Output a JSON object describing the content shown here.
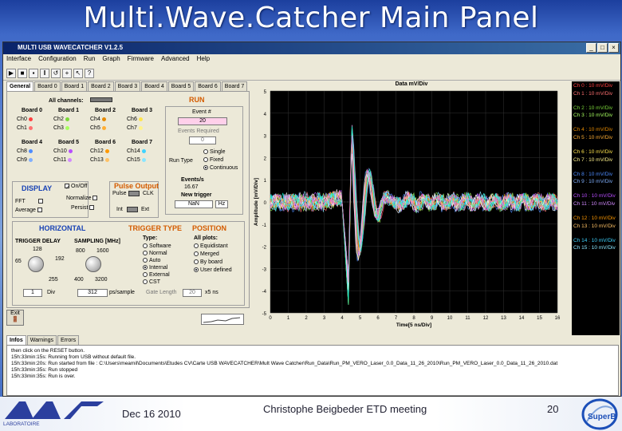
{
  "slide": {
    "title": "Multi.Wave.Catcher  Main Panel",
    "date": "Dec 16 2010",
    "meeting": "Christophe Beigbeder ETD meeting",
    "page": "20",
    "logo_left": "LABORATOIRE DE L'ACCÉLÉRATEUR LINÉAIRE",
    "logo_right": "SuperB"
  },
  "window": {
    "title": "MULTI USB WAVECATCHER V1.2.5",
    "menu": [
      "Interface",
      "Configuration",
      "Run",
      "Graph",
      "Firmware",
      "Advanced",
      "Help"
    ]
  },
  "tabs": [
    "General",
    "Board 0",
    "Board 1",
    "Board 2",
    "Board 3",
    "Board 4",
    "Board 5",
    "Board 6",
    "Board 7"
  ],
  "panel": {
    "all_channels": "All channels:",
    "boards": [
      {
        "name": "Board 0",
        "ch": [
          "Ch0",
          "Ch1"
        ]
      },
      {
        "name": "Board 1",
        "ch": [
          "Ch2",
          "Ch3"
        ]
      },
      {
        "name": "Board 2",
        "ch": [
          "Ch4",
          "Ch5"
        ]
      },
      {
        "name": "Board 3",
        "ch": [
          "Ch6",
          "Ch7"
        ]
      },
      {
        "name": "Board 4",
        "ch": [
          "Ch8",
          "Ch9"
        ]
      },
      {
        "name": "Board 5",
        "ch": [
          "Ch10",
          "Ch11"
        ]
      },
      {
        "name": "Board 6",
        "ch": [
          "Ch12",
          "Ch13"
        ]
      },
      {
        "name": "Board 7",
        "ch": [
          "Ch14",
          "Ch15"
        ]
      }
    ],
    "run": {
      "label": "RUN",
      "event_label": "Event #",
      "event_value": "20",
      "events_required_label": "Events Required",
      "events_required_value": "0",
      "run_type_label": "Run Type",
      "run_types": [
        "Single",
        "Fixed",
        "Continuous"
      ],
      "events_per_s_label": "Events/s",
      "events_per_s_value": "16.67",
      "new_trigger_label": "New trigger",
      "new_trigger_value": "NaN",
      "hz": "Hz"
    },
    "display": {
      "label": "DISPLAY",
      "onoff": "On/Off",
      "fft": "FFT",
      "average": "Average",
      "normalize": "Normalize",
      "persist": "Persist"
    },
    "pulse": {
      "label": "Pulse Output",
      "pulse": "Pulse",
      "clk": "CLK",
      "int": "Int",
      "ext": "Ext"
    },
    "horizontal": {
      "label": "HORIZONTAL",
      "trig_delay": "TRIGGER DELAY",
      "sampling": "SAMPLING [MHz]",
      "knob1_ticks": [
        "128",
        "65",
        "192",
        "255"
      ],
      "knob2_ticks": [
        "800",
        "1600",
        "400",
        "3200"
      ],
      "div_value": "1",
      "div_label": "Div",
      "ps_value": "312",
      "ps_label": "ps/sample"
    },
    "trigger": {
      "label": "TRIGGER TYPE",
      "type_label": "Type:",
      "types": [
        "Software",
        "Normal",
        "Auto",
        "Internal",
        "External",
        "CST"
      ],
      "length_label": "Gate Length",
      "length_value": "20",
      "length_unit": "x5 ns"
    },
    "position": {
      "label": "POSITION",
      "all_plots": "All plots:",
      "options": [
        "Equidistant",
        "Merged",
        "By board",
        "User defined"
      ]
    }
  },
  "plot": {
    "title": "Data mV/Div",
    "xlabel": "Time[5 ns/Div]",
    "ylabel": "Amplitude [mV/Div]",
    "yticks": [
      "5",
      "4",
      "3",
      "2",
      "1",
      "0",
      "-1",
      "-2",
      "-3",
      "-4",
      "-5"
    ],
    "xticks": [
      "0",
      "1",
      "2",
      "3",
      "4",
      "5",
      "6",
      "7",
      "8",
      "9",
      "10",
      "11",
      "12",
      "13",
      "14",
      "15",
      "16"
    ]
  },
  "legend": [
    {
      "text": "Ch 0 : 10 mV/Div",
      "color": "#ff4040"
    },
    {
      "text": "Ch 1 : 10 mV/Div",
      "color": "#ff7070"
    },
    {
      "text": "Ch 2 : 10 mV/Div",
      "color": "#7cd83a"
    },
    {
      "text": "Ch 3 : 10 mV/Div",
      "color": "#a8ff60"
    },
    {
      "text": "Ch 4 : 10 mV/Div",
      "color": "#e68a00"
    },
    {
      "text": "Ch 5 : 10 mV/Div",
      "color": "#ffae33"
    },
    {
      "text": "Ch 6 : 10 mV/Div",
      "color": "#ffe54d"
    },
    {
      "text": "Ch 7 : 10 mV/Div",
      "color": "#fff38a"
    },
    {
      "text": "Ch 8 : 10 mV/Div",
      "color": "#4d8cff"
    },
    {
      "text": "Ch 9 : 10 mV/Div",
      "color": "#80b0ff"
    },
    {
      "text": "Ch 10 : 10 mV/Div",
      "color": "#b84dff"
    },
    {
      "text": "Ch 11 : 10 mV/Div",
      "color": "#d38aff"
    },
    {
      "text": "Ch 12 : 10 mV/Div",
      "color": "#ff9900"
    },
    {
      "text": "Ch 13 : 10 mV/Div",
      "color": "#ffc266"
    },
    {
      "text": "Ch 14 : 10 mV/Div",
      "color": "#3fd3ff"
    },
    {
      "text": "Ch 15 : 10 mV/Div",
      "color": "#8ae6ff"
    }
  ],
  "log": {
    "tabs": [
      "Infos",
      "Warnings",
      "Errors"
    ],
    "lines": [
      "then click on the RESET button.",
      "15h:33min:15s: Running from USB without default file.",
      "15h:33min:20s: Run started from file : C:\\Users\\meamil\\Documents\\Etudes CV\\Carte USB WAVECATCHER\\Mult Wave Catcher\\Run_Data\\Run_PM_VERO_Laser_0.0_Data_11_26_2010\\Run_PM_VERO_Laser_0.0_Data_11_26_2010.dat",
      "15h:33min:35s: Run stopped",
      "15h:33min:35s: Run is over."
    ]
  },
  "exit": "Exit"
}
